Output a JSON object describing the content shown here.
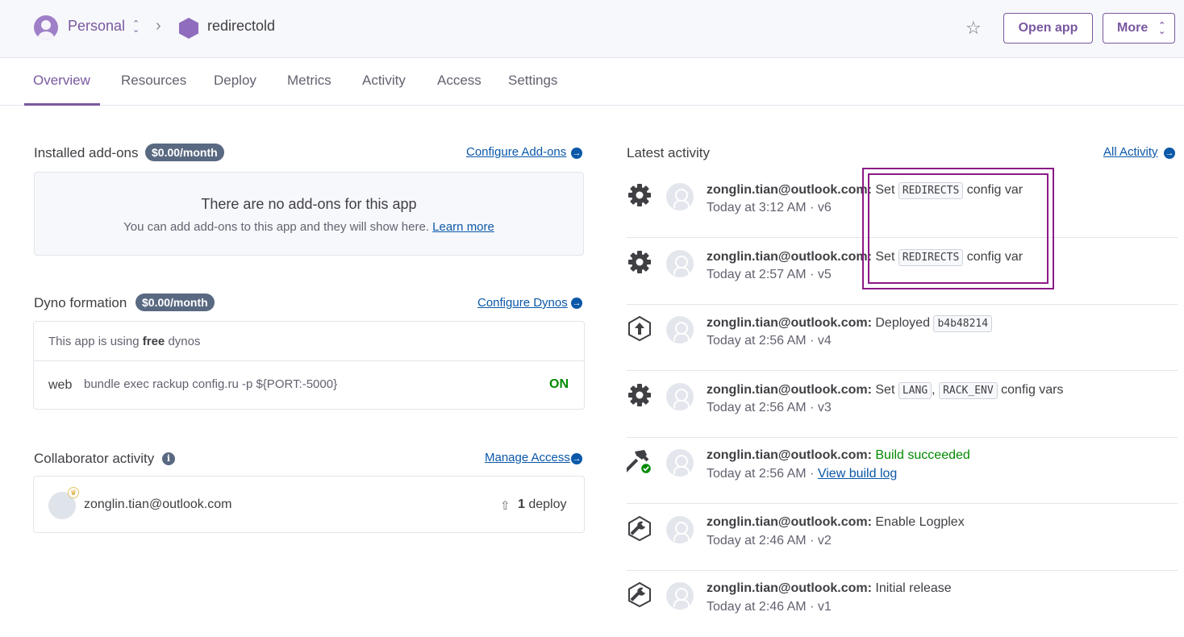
{
  "header": {
    "team_label": "Personal",
    "app_name": "redirectold",
    "open_app_label": "Open app",
    "more_label": "More"
  },
  "tabs": [
    {
      "label": "Overview",
      "active": true
    },
    {
      "label": "Resources",
      "active": false
    },
    {
      "label": "Deploy",
      "active": false
    },
    {
      "label": "Metrics",
      "active": false
    },
    {
      "label": "Activity",
      "active": false
    },
    {
      "label": "Access",
      "active": false
    },
    {
      "label": "Settings",
      "active": false
    }
  ],
  "addons": {
    "title": "Installed add-ons",
    "cost": "$0.00/month",
    "configure_label": "Configure Add-ons",
    "empty_title": "There are no add-ons for this app",
    "empty_text": "You can add add-ons to this app and they will show here.",
    "learn_more": "Learn more"
  },
  "dynos": {
    "title": "Dyno formation",
    "cost": "$0.00/month",
    "configure_label": "Configure Dynos",
    "using_prefix": "This app is using",
    "using_bold": "free",
    "using_suffix": "dynos",
    "process_type": "web",
    "command": "bundle exec rackup config.ru -p ${PORT:-5000}",
    "state": "ON"
  },
  "collaborators": {
    "title": "Collaborator activity",
    "manage_label": "Manage Access",
    "email": "zonglin.tian@outlook.com",
    "deploy_count": "1",
    "deploy_word": "deploy"
  },
  "activity": {
    "title": "Latest activity",
    "all_label": "All Activity",
    "items": [
      {
        "icon": "gear-icon",
        "user": "zonglin.tian@outlook.com:",
        "pre": "Set",
        "code1": "REDIRECTS",
        "mid": "",
        "code2": "",
        "post": "config var",
        "time": "Today at 3:12 AM · v6"
      },
      {
        "icon": "gear-icon",
        "user": "zonglin.tian@outlook.com:",
        "pre": "Set",
        "code1": "REDIRECTS",
        "mid": "",
        "code2": "",
        "post": "config var",
        "time": "Today at 2:57 AM · v5"
      },
      {
        "icon": "deploy-icon",
        "user": "zonglin.tian@outlook.com:",
        "pre": "Deployed",
        "code1": "b4b48214",
        "mid": "",
        "code2": "",
        "post": "",
        "time": "Today at 2:56 AM · v4"
      },
      {
        "icon": "gear-icon",
        "user": "zonglin.tian@outlook.com:",
        "pre": "Set",
        "code1": "LANG",
        "mid": ",",
        "code2": "RACK_ENV",
        "post": "config vars",
        "time": "Today at 2:56 AM · v3"
      },
      {
        "icon": "build-success-icon",
        "user": "zonglin.tian@outlook.com:",
        "status": "Build succeeded",
        "time": "Today at 2:56 AM ·",
        "link": "View build log"
      },
      {
        "icon": "wrench-icon",
        "user": "zonglin.tian@outlook.com:",
        "pre": "Enable Logplex",
        "time": "Today at 2:46 AM · v2"
      },
      {
        "icon": "wrench-icon",
        "user": "zonglin.tian@outlook.com:",
        "pre": "Initial release",
        "time": "Today at 2:46 AM · v1"
      }
    ]
  },
  "colors": {
    "accent": "#79589f",
    "highlight": "#8b1a86",
    "success": "#008a00",
    "link": "#0b58a8"
  }
}
